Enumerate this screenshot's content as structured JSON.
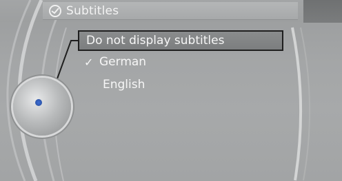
{
  "header": {
    "title": "Subtitles",
    "icon": "subtitles-settings-icon"
  },
  "menu": {
    "items": [
      {
        "label": "Do not display subtitles",
        "selected": true,
        "checked": false
      },
      {
        "label": "German",
        "selected": false,
        "checked": true,
        "check_mark": "✓"
      },
      {
        "label": "English",
        "selected": false,
        "checked": false
      }
    ]
  },
  "controller": {
    "icon": "controller-knob-icon"
  },
  "colors": {
    "background": "#a5a7a8",
    "text": "#f6f6f6",
    "selection_border": "#1f1f1f",
    "controller_dot": "#3b6dd8"
  }
}
